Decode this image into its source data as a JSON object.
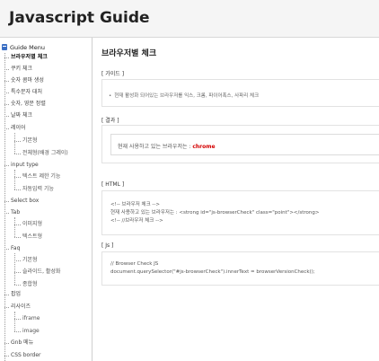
{
  "header": {
    "title": "Javascript Guide"
  },
  "sidebar": {
    "root_label": "Guide Menu",
    "items": [
      {
        "label": "브라우저별 체크"
      },
      {
        "label": "쿠키 체크"
      },
      {
        "label": "숫자 콤마 생성"
      },
      {
        "label": "특수문자 대처"
      },
      {
        "label": "숫자, 영문 정렬"
      },
      {
        "label": "날짜 체크"
      },
      {
        "label": "레이어"
      },
      {
        "label": "기본형"
      },
      {
        "label": "전체형(배경 그레이)"
      },
      {
        "label": "input type"
      },
      {
        "label": "텍스트 제한 기능"
      },
      {
        "label": "자동입력 기능"
      },
      {
        "label": "Select box"
      },
      {
        "label": "Tab"
      },
      {
        "label": "이미지형"
      },
      {
        "label": "텍스트형"
      },
      {
        "label": "Faq"
      },
      {
        "label": "기본형"
      },
      {
        "label": "슬라이드, 활성화"
      },
      {
        "label": "종합형"
      },
      {
        "label": "팝업"
      },
      {
        "label": "리사이즈"
      },
      {
        "label": "iframe"
      },
      {
        "label": "image"
      },
      {
        "label": "Gnb 메뉴"
      },
      {
        "label": "CSS border"
      }
    ]
  },
  "main": {
    "page_title": "브라우저별 체크",
    "guide": {
      "label": "[ 가이드 ]",
      "bullet": "•",
      "text": "현재 활성화 되어있는 브라우저를 익스, 크롬, 파이어폭스, 사파리 체크"
    },
    "result": {
      "label": "[ 결과 ]",
      "prefix": "현재 사용하고 있는 브라우저는 :",
      "value": "chrome"
    },
    "html_code": {
      "label": "[ HTML ]",
      "lines": [
        "<!-- 브라우저 체크 -->",
        "현재 사용하고 있는 브라우저는 : <strong id=\"js-browserCheck\" class=\"point\"></strong>",
        "<!-- //브라우저 체크 -->"
      ]
    },
    "js_code": {
      "label": "[ Js ]",
      "lines": [
        "// Browser Check JS",
        "document.querySelector(\"#js-browserCheck\").innerText = browserVersionCheck();"
      ]
    }
  },
  "colors": {
    "accent": "#d40000",
    "header_bg": "#f5f5f5",
    "root_icon": "#3b6fc4"
  }
}
